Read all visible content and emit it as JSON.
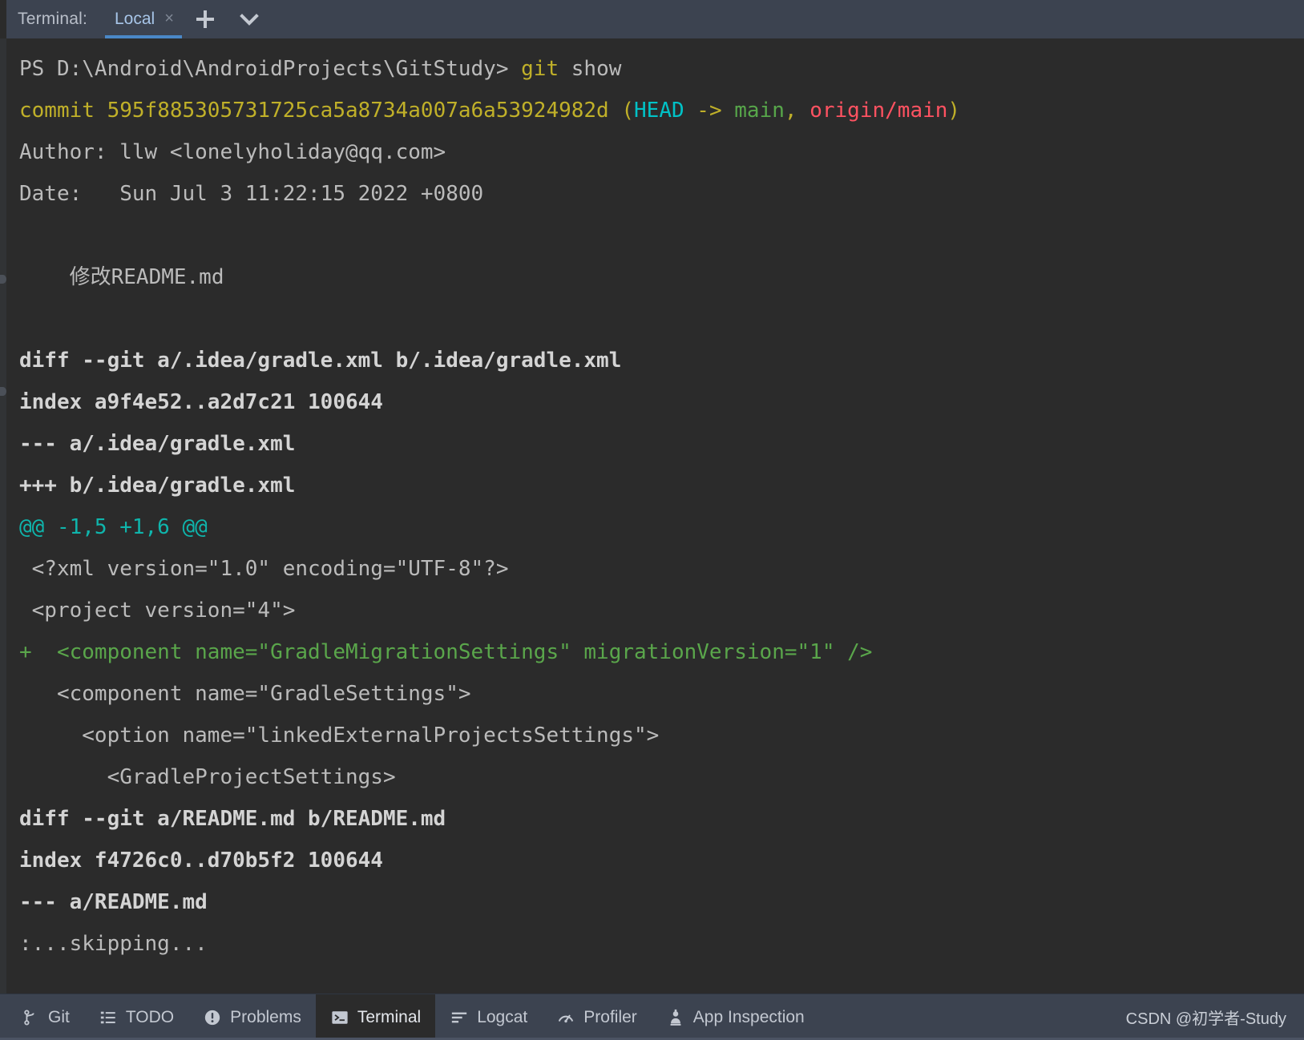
{
  "tabbar": {
    "label": "Terminal:",
    "tab_name": "Local",
    "close_glyph": "×",
    "add_icon": "plus-icon",
    "dropdown_icon": "chevron-down-icon",
    "accent_color": "#4a88c7",
    "background": "#3c4350"
  },
  "terminal": {
    "prompt": {
      "path": "PS D:\\Android\\AndroidProjects\\GitStudy> ",
      "command": "git",
      "command_arg": " show"
    },
    "commit": {
      "keyword": "commit ",
      "hash": "595f885305731725ca5a8734a007a6a53924982d",
      "paren_open": " (",
      "head": "HEAD",
      "arrow": " -> ",
      "branch": "main",
      "comma": ", ",
      "remote": "origin/main",
      "paren_close": ")"
    },
    "author": "Author: llw <lonelyholiday@qq.com>",
    "date": "Date:   Sun Jul 3 11:22:15 2022 +0800",
    "message": "    修改README.md",
    "diff_lines": [
      {
        "text": "diff --git a/.idea/gradle.xml b/.idea/gradle.xml",
        "style": "bold-white"
      },
      {
        "text": "index a9f4e52..a2d7c21 100644",
        "style": "bold-white"
      },
      {
        "text": "--- a/.idea/gradle.xml",
        "style": "bold-white"
      },
      {
        "text": "+++ b/.idea/gradle.xml",
        "style": "bold-white"
      },
      {
        "text": "@@ -1,5 +1,6 @@",
        "style": "teal"
      },
      {
        "text": " <?xml version=\"1.0\" encoding=\"UTF-8\"?>",
        "style": "default"
      },
      {
        "text": " <project version=\"4\">",
        "style": "default"
      },
      {
        "text": "+  <component name=\"GradleMigrationSettings\" migrationVersion=\"1\" />",
        "style": "add"
      },
      {
        "text": "   <component name=\"GradleSettings\">",
        "style": "default"
      },
      {
        "text": "     <option name=\"linkedExternalProjectsSettings\">",
        "style": "default"
      },
      {
        "text": "       <GradleProjectSettings>",
        "style": "default"
      },
      {
        "text": "diff --git a/README.md b/README.md",
        "style": "bold-white"
      },
      {
        "text": "index f4726c0..d70b5f2 100644",
        "style": "bold-white"
      },
      {
        "text": "--- a/README.md",
        "style": "bold-white"
      },
      {
        "text": ":...skipping...",
        "style": "default"
      }
    ],
    "colors": {
      "background": "#2b2b2b",
      "foreground": "#bbbbbb",
      "yellow": "#c0b029",
      "cyan": "#00c2c7",
      "green": "#57a64a",
      "red": "#ff5261",
      "teal": "#0fb5ac",
      "add_green": "#5aa64b"
    }
  },
  "statusbar": {
    "items": [
      {
        "label": "Git",
        "icon": "git-branch-icon",
        "active": false
      },
      {
        "label": "TODO",
        "icon": "list-icon",
        "active": false
      },
      {
        "label": "Problems",
        "icon": "exclamation-circle-icon",
        "active": false
      },
      {
        "label": "Terminal",
        "icon": "terminal-icon",
        "active": true
      },
      {
        "label": "Logcat",
        "icon": "logcat-lines-icon",
        "active": false
      },
      {
        "label": "Profiler",
        "icon": "gauge-icon",
        "active": false
      },
      {
        "label": "App Inspection",
        "icon": "person-inspect-icon",
        "active": false
      }
    ],
    "watermark": "CSDN @初学者-Study"
  }
}
